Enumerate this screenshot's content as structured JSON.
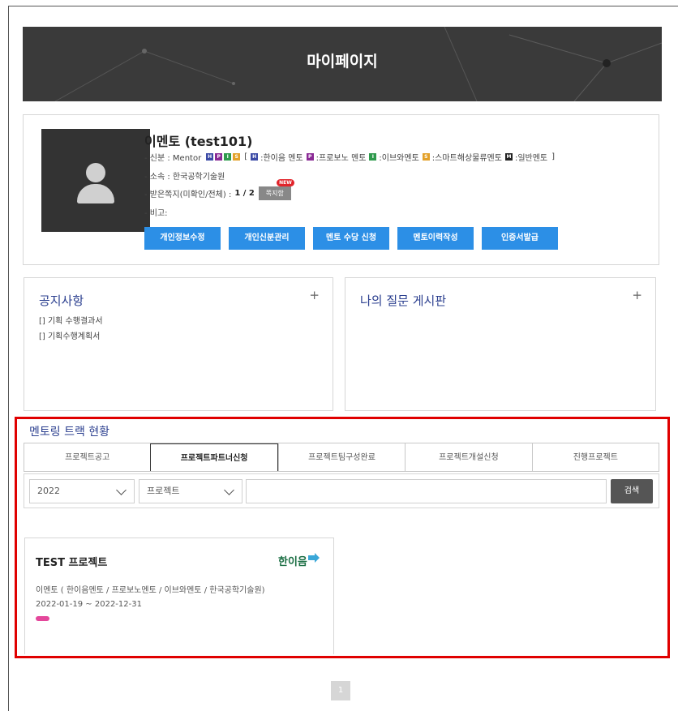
{
  "header": {
    "title": "마이페이지"
  },
  "profile": {
    "name": "이멘토 (test101)",
    "role_label": "- 신분 : Mentor",
    "role_badges": [
      "H",
      "P",
      "I",
      "S"
    ],
    "legend_open": "[",
    "legend": [
      {
        "badge": "H",
        "label": ":한이음 멘토"
      },
      {
        "badge": "P",
        "label": ":프로보노 멘토"
      },
      {
        "badge": "I",
        "label": ":이브와멘토"
      },
      {
        "badge": "S",
        "label": ":스마트해상물류멘토"
      },
      {
        "badge": "M",
        "label": ":일반멘토"
      }
    ],
    "legend_close": "]",
    "affiliation": "- 소속 : 한국공학기술원",
    "messages_label": "- 받은쪽지(미확인/전체) :",
    "messages_count": "1 / 2",
    "messages_button": "쪽지함",
    "new_tag": "NEW",
    "note": "- 비고:",
    "actions": [
      "개인정보수정",
      "개인신분관리",
      "멘토 수당 신청",
      "멘토이력작성",
      "인증서발급"
    ]
  },
  "notice": {
    "title": "공지사항",
    "plus": "+",
    "items": [
      "[] 기획 수행결과서",
      "[] 기획수행계획서"
    ]
  },
  "qna": {
    "title": "나의 질문 게시판",
    "plus": "+"
  },
  "track": {
    "title": "멘토링 트랙 현황",
    "tabs": [
      "프로젝트공고",
      "프로젝트파트너신청",
      "프로젝트팀구성완료",
      "프로젝트개설신청",
      "진행프로젝트"
    ],
    "active_tab": 1,
    "year": "2022",
    "type": "프로젝트",
    "search_button": "검색",
    "search_value": ""
  },
  "project": {
    "title": "TEST 프로젝트",
    "logo": "한이음",
    "members": "이멘토 ( 한이음멘토 / 프로보노멘토 / 이브와멘토 / 한국공학기술원)",
    "period": "2022-01-19 ~ 2022-12-31",
    "tag_color": "#e4479b"
  },
  "pagination": {
    "current": "1"
  },
  "colors": {
    "accent_blue": "#2c8fe6",
    "highlight_red": "#e00000",
    "title_navy": "#2b3f8f"
  }
}
